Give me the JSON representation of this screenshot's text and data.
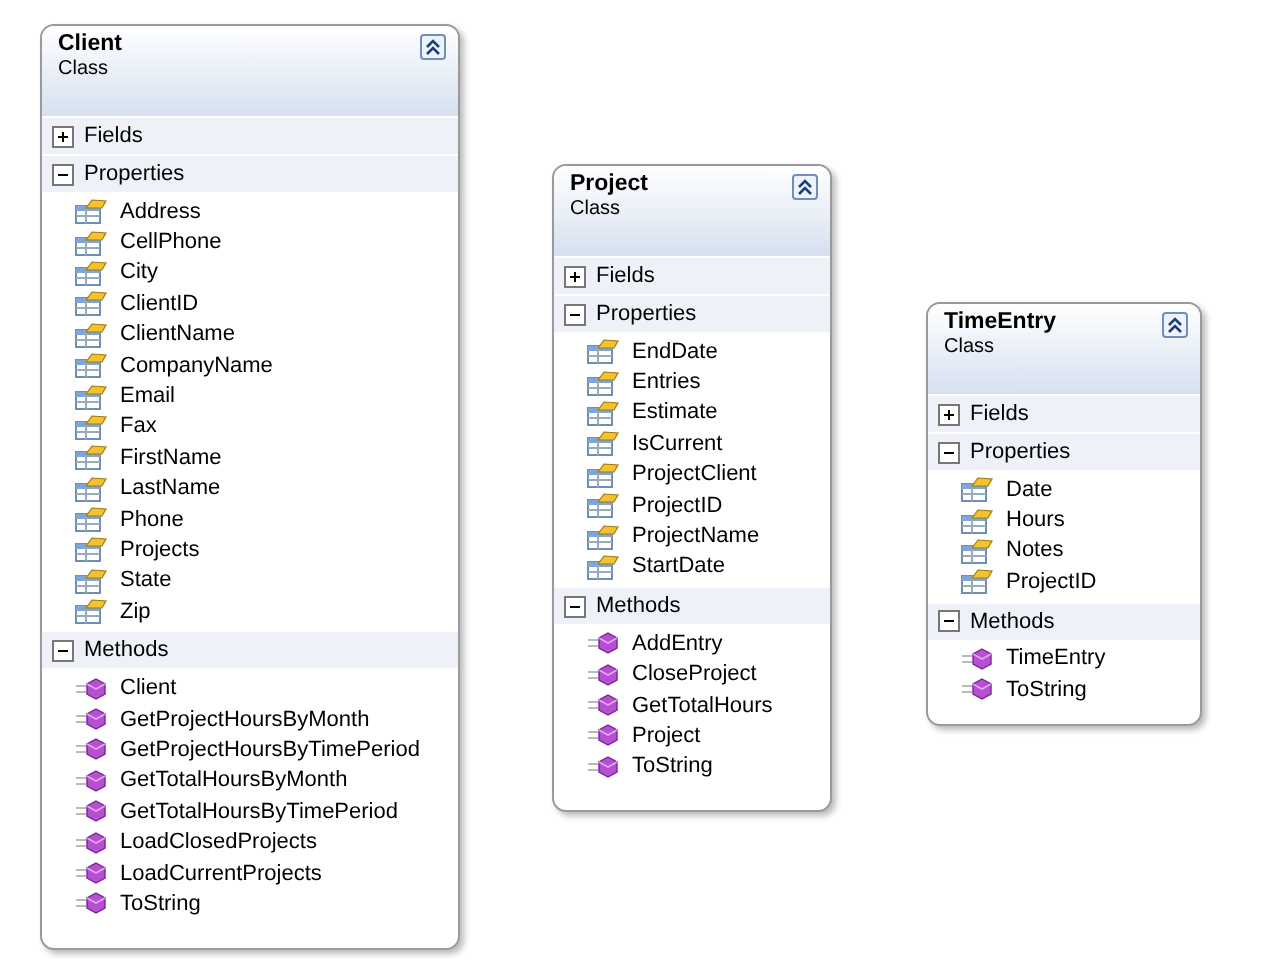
{
  "classes": [
    {
      "name": "Client",
      "stereotype": "Class",
      "sections": [
        {
          "title": "Fields",
          "expanded": false
        },
        {
          "title": "Properties",
          "expanded": true,
          "members": [
            {
              "name": "Address",
              "kind": "property"
            },
            {
              "name": "CellPhone",
              "kind": "property"
            },
            {
              "name": "City",
              "kind": "property"
            },
            {
              "name": "ClientID",
              "kind": "property"
            },
            {
              "name": "ClientName",
              "kind": "property"
            },
            {
              "name": "CompanyName",
              "kind": "property"
            },
            {
              "name": "Email",
              "kind": "property"
            },
            {
              "name": "Fax",
              "kind": "property"
            },
            {
              "name": "FirstName",
              "kind": "property"
            },
            {
              "name": "LastName",
              "kind": "property"
            },
            {
              "name": "Phone",
              "kind": "property"
            },
            {
              "name": "Projects",
              "kind": "property"
            },
            {
              "name": "State",
              "kind": "property"
            },
            {
              "name": "Zip",
              "kind": "property"
            }
          ]
        },
        {
          "title": "Methods",
          "expanded": true,
          "members": [
            {
              "name": "Client",
              "kind": "method"
            },
            {
              "name": "GetProjectHoursByMonth",
              "kind": "method"
            },
            {
              "name": "GetProjectHoursByTimePeriod",
              "kind": "method"
            },
            {
              "name": "GetTotalHoursByMonth",
              "kind": "method"
            },
            {
              "name": "GetTotalHoursByTimePeriod",
              "kind": "method"
            },
            {
              "name": "LoadClosedProjects",
              "kind": "method"
            },
            {
              "name": "LoadCurrentProjects",
              "kind": "method"
            },
            {
              "name": "ToString",
              "kind": "method"
            }
          ]
        }
      ]
    },
    {
      "name": "Project",
      "stereotype": "Class",
      "sections": [
        {
          "title": "Fields",
          "expanded": false
        },
        {
          "title": "Properties",
          "expanded": true,
          "members": [
            {
              "name": "EndDate",
              "kind": "property"
            },
            {
              "name": "Entries",
              "kind": "property"
            },
            {
              "name": "Estimate",
              "kind": "property"
            },
            {
              "name": "IsCurrent",
              "kind": "property"
            },
            {
              "name": "ProjectClient",
              "kind": "property"
            },
            {
              "name": "ProjectID",
              "kind": "property"
            },
            {
              "name": "ProjectName",
              "kind": "property"
            },
            {
              "name": "StartDate",
              "kind": "property"
            }
          ]
        },
        {
          "title": "Methods",
          "expanded": true,
          "members": [
            {
              "name": "AddEntry",
              "kind": "method"
            },
            {
              "name": "CloseProject",
              "kind": "method"
            },
            {
              "name": "GetTotalHours",
              "kind": "method"
            },
            {
              "name": "Project",
              "kind": "method"
            },
            {
              "name": "ToString",
              "kind": "method"
            }
          ]
        }
      ]
    },
    {
      "name": "TimeEntry",
      "stereotype": "Class",
      "sections": [
        {
          "title": "Fields",
          "expanded": false
        },
        {
          "title": "Properties",
          "expanded": true,
          "members": [
            {
              "name": "Date",
              "kind": "property"
            },
            {
              "name": "Hours",
              "kind": "property"
            },
            {
              "name": "Notes",
              "kind": "property"
            },
            {
              "name": "ProjectID",
              "kind": "property"
            }
          ]
        },
        {
          "title": "Methods",
          "expanded": true,
          "members": [
            {
              "name": "TimeEntry",
              "kind": "method"
            },
            {
              "name": "ToString",
              "kind": "method"
            }
          ]
        }
      ]
    }
  ]
}
